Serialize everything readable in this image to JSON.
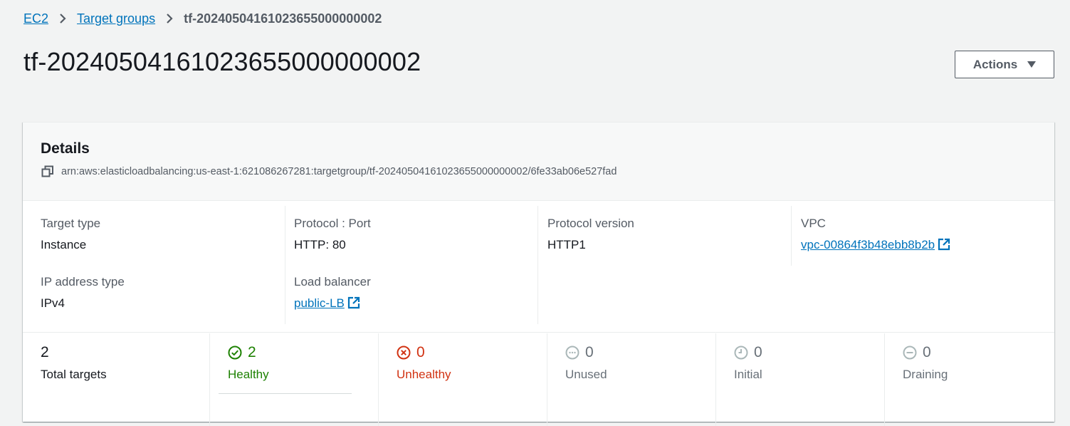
{
  "breadcrumb": {
    "items": [
      "EC2",
      "Target groups"
    ],
    "current": "tf-20240504161023655000000002"
  },
  "page": {
    "title": "tf-20240504161023655000000002",
    "actions_label": "Actions"
  },
  "details": {
    "title": "Details",
    "arn": "arn:aws:elasticloadbalancing:us-east-1:621086267281:targetgroup/tf-20240504161023655000000002/6fe33ab06e527fad",
    "fields": {
      "target_type": {
        "label": "Target type",
        "value": "Instance"
      },
      "ip_address_type": {
        "label": "IP address type",
        "value": "IPv4"
      },
      "protocol_port": {
        "label": "Protocol : Port",
        "value": "HTTP: 80"
      },
      "load_balancer": {
        "label": "Load balancer",
        "value": "public-LB"
      },
      "protocol_version": {
        "label": "Protocol version",
        "value": "HTTP1"
      },
      "vpc": {
        "label": "VPC",
        "value": "vpc-00864f3b48ebb8b2b"
      }
    }
  },
  "stats": {
    "total": {
      "count": "2",
      "label": "Total targets"
    },
    "healthy": {
      "count": "2",
      "label": "Healthy",
      "color": "#1d8102",
      "icon": "check-circle-icon"
    },
    "unhealthy": {
      "count": "0",
      "label": "Unhealthy",
      "color": "#d13212",
      "icon": "x-circle-icon"
    },
    "unused": {
      "count": "0",
      "label": "Unused",
      "color": "#687078",
      "icon": "ellipsis-circle-icon"
    },
    "initial": {
      "count": "0",
      "label": "Initial",
      "color": "#687078",
      "icon": "clock-icon"
    },
    "draining": {
      "count": "0",
      "label": "Draining",
      "color": "#687078",
      "icon": "minus-circle-icon"
    }
  }
}
